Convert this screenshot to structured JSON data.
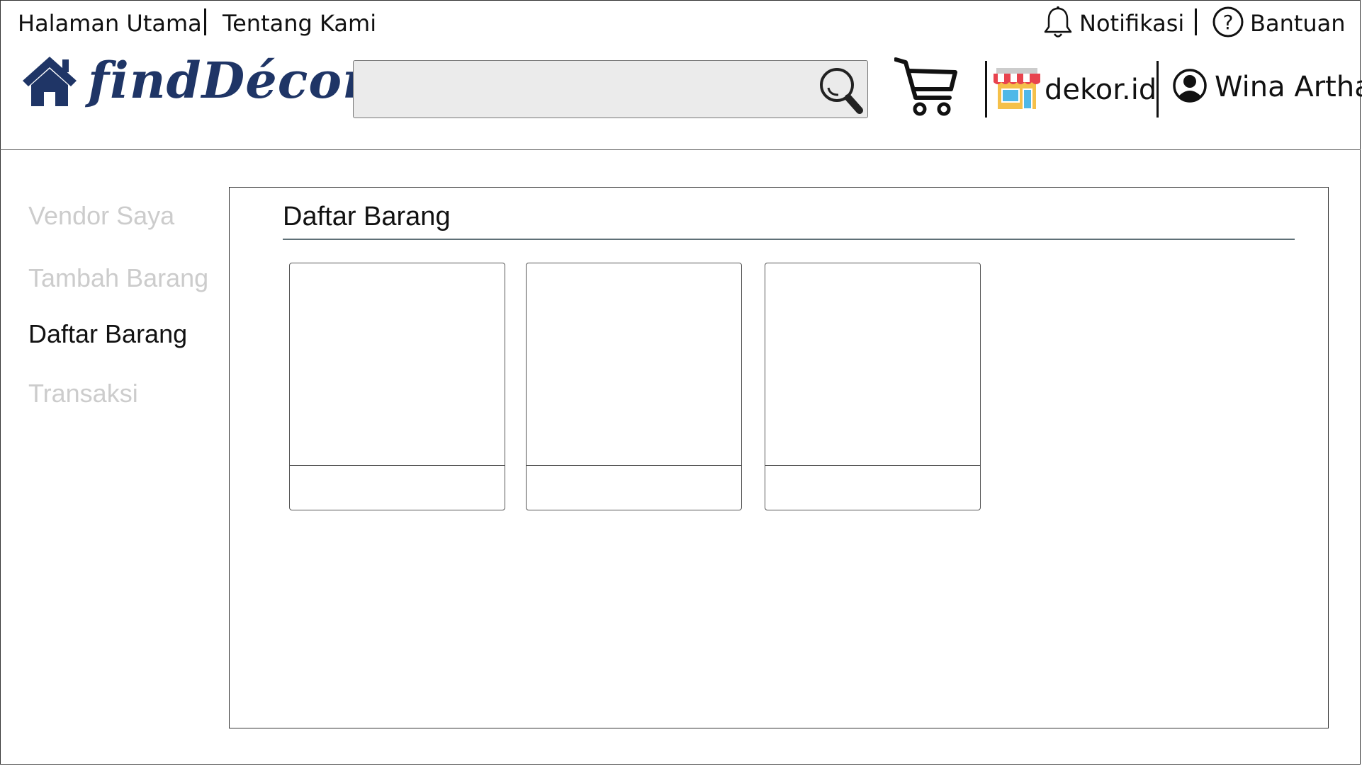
{
  "topnav": {
    "home": "Halaman Utama",
    "about": "Tentang Kami",
    "notifications": "Notifikasi",
    "help": "Bantuan"
  },
  "brand": {
    "name": "findDécor",
    "color": "#1f3566"
  },
  "search": {
    "placeholder": "",
    "value": ""
  },
  "store": {
    "name": "dekor.id"
  },
  "user": {
    "name": "Wina Artha"
  },
  "sidebar": {
    "items": [
      {
        "label": "Vendor Saya",
        "active": false
      },
      {
        "label": "Tambah Barang",
        "active": false
      },
      {
        "label": "Daftar Barang",
        "active": true
      },
      {
        "label": "Transaksi",
        "active": false
      }
    ]
  },
  "content": {
    "title": "Daftar Barang",
    "cards": [
      {
        "caption": ""
      },
      {
        "caption": ""
      },
      {
        "caption": ""
      }
    ]
  },
  "colors": {
    "inactive_text": "#cccccc",
    "active_text": "#111111",
    "search_bg": "#ebebeb"
  }
}
